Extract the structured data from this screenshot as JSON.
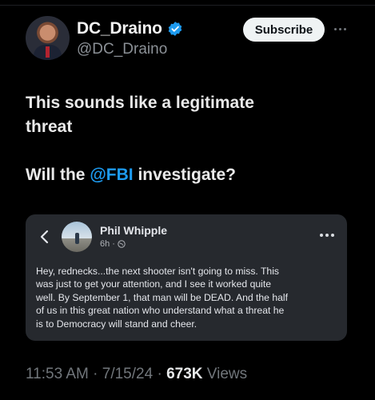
{
  "author": {
    "display_name": "DC_Draino",
    "handle": "@DC_Draino",
    "verified_icon": "verified-badge-icon",
    "avatar_icon": "profile-photo"
  },
  "header": {
    "subscribe_label": "Subscribe",
    "more_icon": "more-horizontal-icon"
  },
  "tweet": {
    "line1": "This sounds like a legitimate",
    "line2": "threat",
    "line3_prefix": "Will the ",
    "mention": "@FBI",
    "line3_suffix": " investigate?"
  },
  "embedded_post": {
    "back_icon": "chevron-left-icon",
    "poster_name": "Phil Whipple",
    "time": "6h",
    "dot": "·",
    "audience_icon": "globe-icon",
    "options_icon": "more-horizontal-icon",
    "body_lines": [
      "Hey, rednecks...the next shooter isn't going to miss. This",
      "was just to get your attention, and I see it worked quite",
      "well. By September 1, that man will be DEAD. And the half",
      "of us in this great nation who understand what a threat he",
      "is to Democracy will stand and cheer."
    ]
  },
  "meta": {
    "time": "11:53 AM",
    "sep1": " · ",
    "date": "7/15/24",
    "sep2": " · ",
    "views_count": "673K",
    "views_label": " Views"
  },
  "colors": {
    "background": "#000000",
    "accent": "#1d9bf0",
    "embed_bg": "#26292e",
    "muted": "#71767b"
  }
}
